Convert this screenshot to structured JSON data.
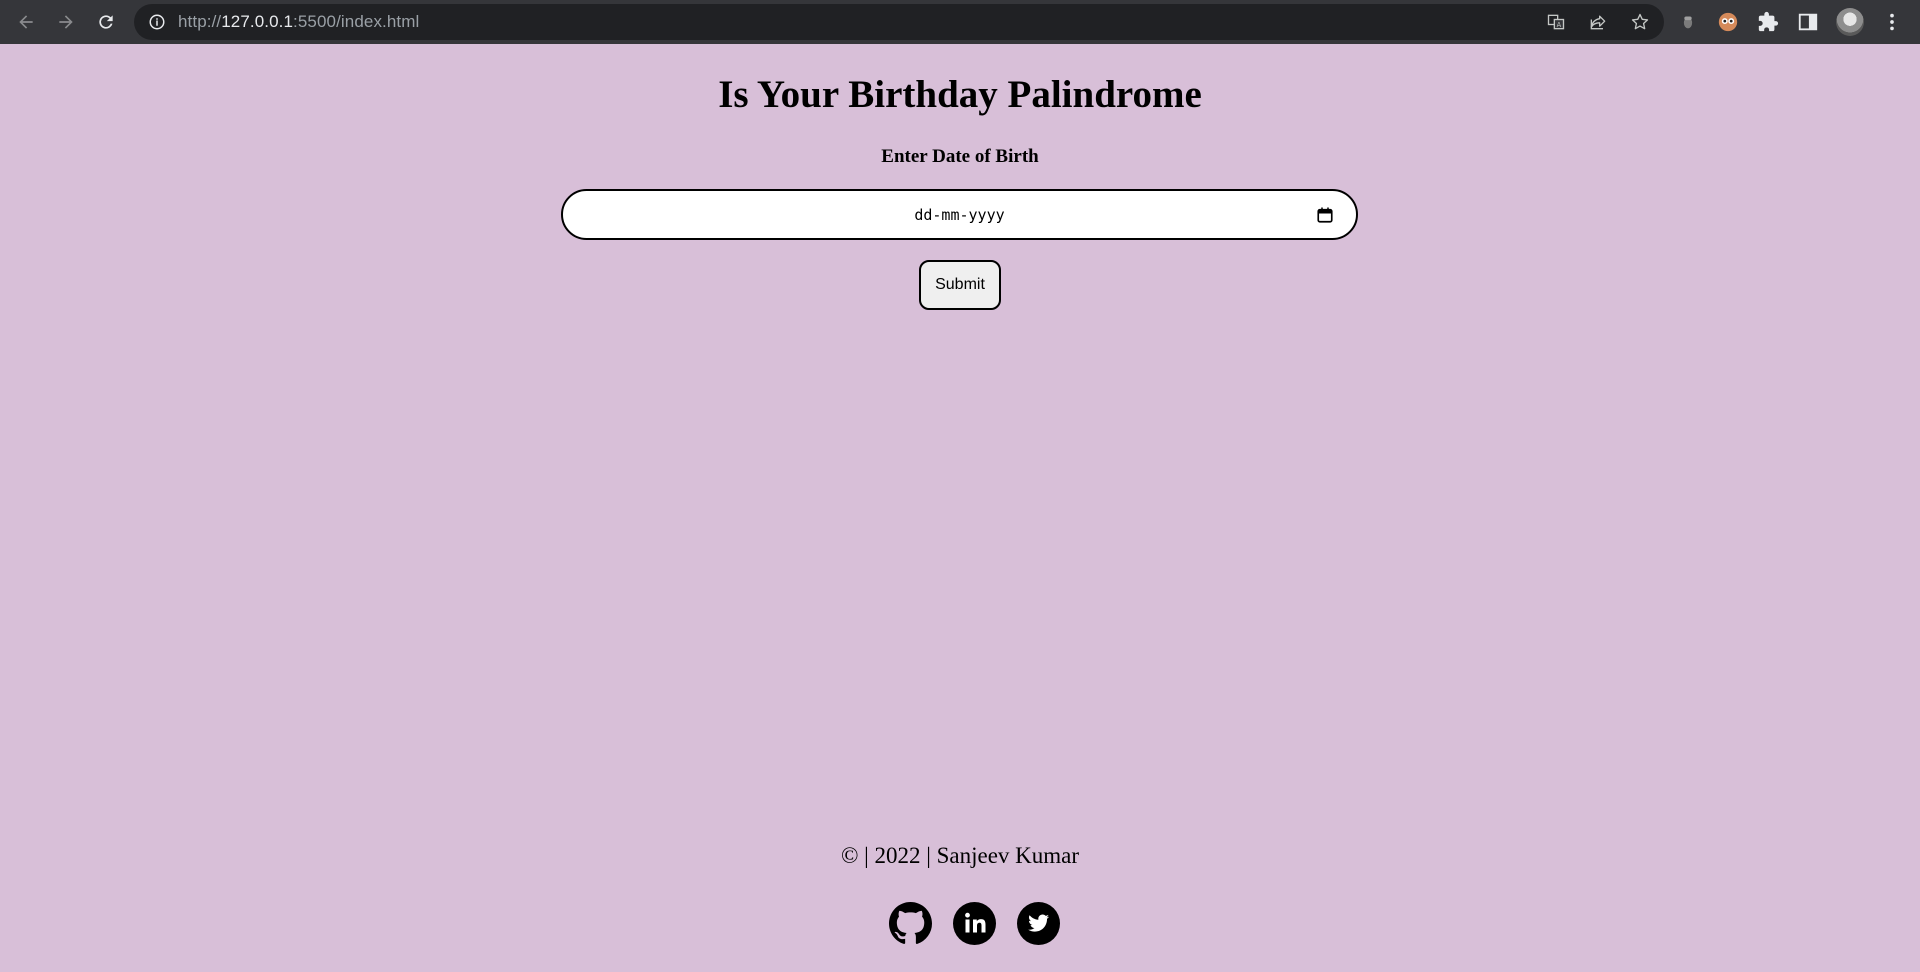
{
  "browser": {
    "url_scheme": "http://",
    "url_host": "127.0.0.1",
    "url_rest": ":5500/index.html"
  },
  "page": {
    "title": "Is Your Birthday Palindrome",
    "dob_label": "Enter Date of Birth",
    "date_placeholder": "dd-mm-yyyy",
    "submit_label": "Submit"
  },
  "footer": {
    "text": "© | 2022 | Sanjeev Kumar",
    "social_icons": [
      "github-icon",
      "linkedin-icon",
      "twitter-icon"
    ]
  },
  "colors": {
    "background": "#d8bfd8",
    "chrome": "#35363a",
    "omnibox": "#202124"
  }
}
